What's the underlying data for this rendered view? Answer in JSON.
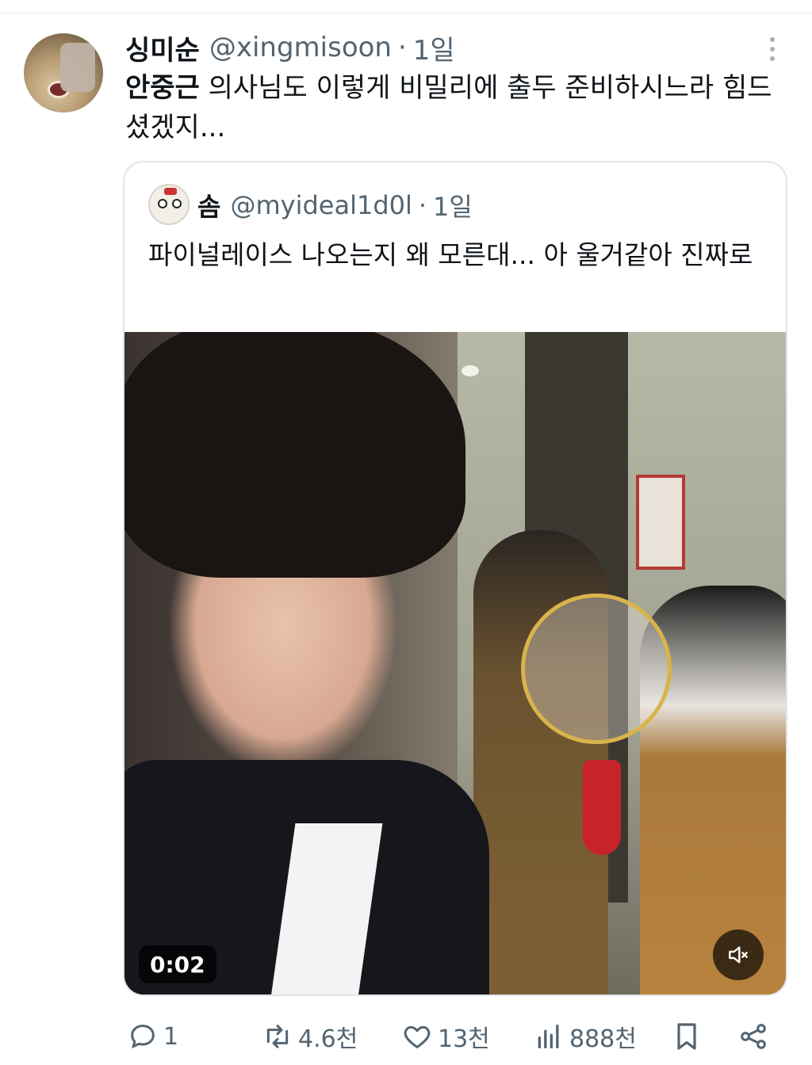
{
  "tweet": {
    "display_name": "싱미순",
    "handle": "@xingmisoon",
    "separator": "·",
    "time": "1일",
    "text_bold": "안중근",
    "text_rest": " 의사님도 이렇게 비밀리에 출두 준비하시느라 힘드셨겠지..."
  },
  "quote": {
    "display_name": "솜",
    "handle": "@myideal1d0l",
    "separator": "·",
    "time": "1일",
    "text": "파이널레이스 나오는지 왜 모른대... 아 울거같아 진짜로",
    "video": {
      "duration": "0:02"
    }
  },
  "actions": {
    "reply_count": "1",
    "retweet_count": "4.6천",
    "like_count": "13천",
    "view_count": "888천"
  },
  "icons": {
    "reply": "reply-icon",
    "retweet": "retweet-icon",
    "like": "heart-icon",
    "views": "views-icon",
    "bookmark": "bookmark-icon",
    "share": "share-icon",
    "more": "more-icon",
    "mute": "mute-icon"
  },
  "colors": {
    "muted_text": "#536471",
    "border": "#dfe4e8"
  }
}
